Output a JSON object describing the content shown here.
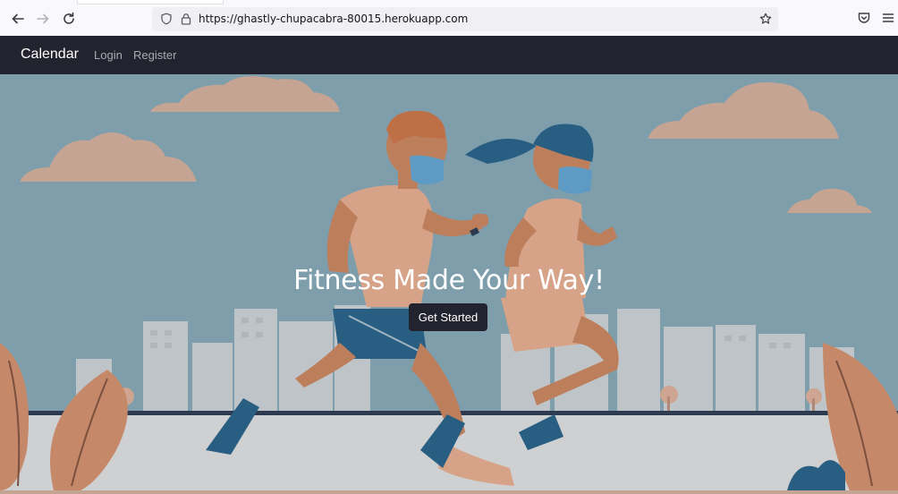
{
  "browser": {
    "url": "https://ghastly-chupacabra-80015.herokuapp.com"
  },
  "navbar": {
    "brand": "Calendar",
    "links": [
      {
        "label": "Login"
      },
      {
        "label": "Register"
      }
    ]
  },
  "hero": {
    "headline": "Fitness Made Your Way!",
    "cta_label": "Get Started"
  },
  "colors": {
    "navbar_bg": "#23232f",
    "sky": "#7fa3b3",
    "cloud": "#d9ab93",
    "skin": "#c77f57",
    "mask": "#5aa0cf",
    "shorts": "#1e5b85"
  }
}
